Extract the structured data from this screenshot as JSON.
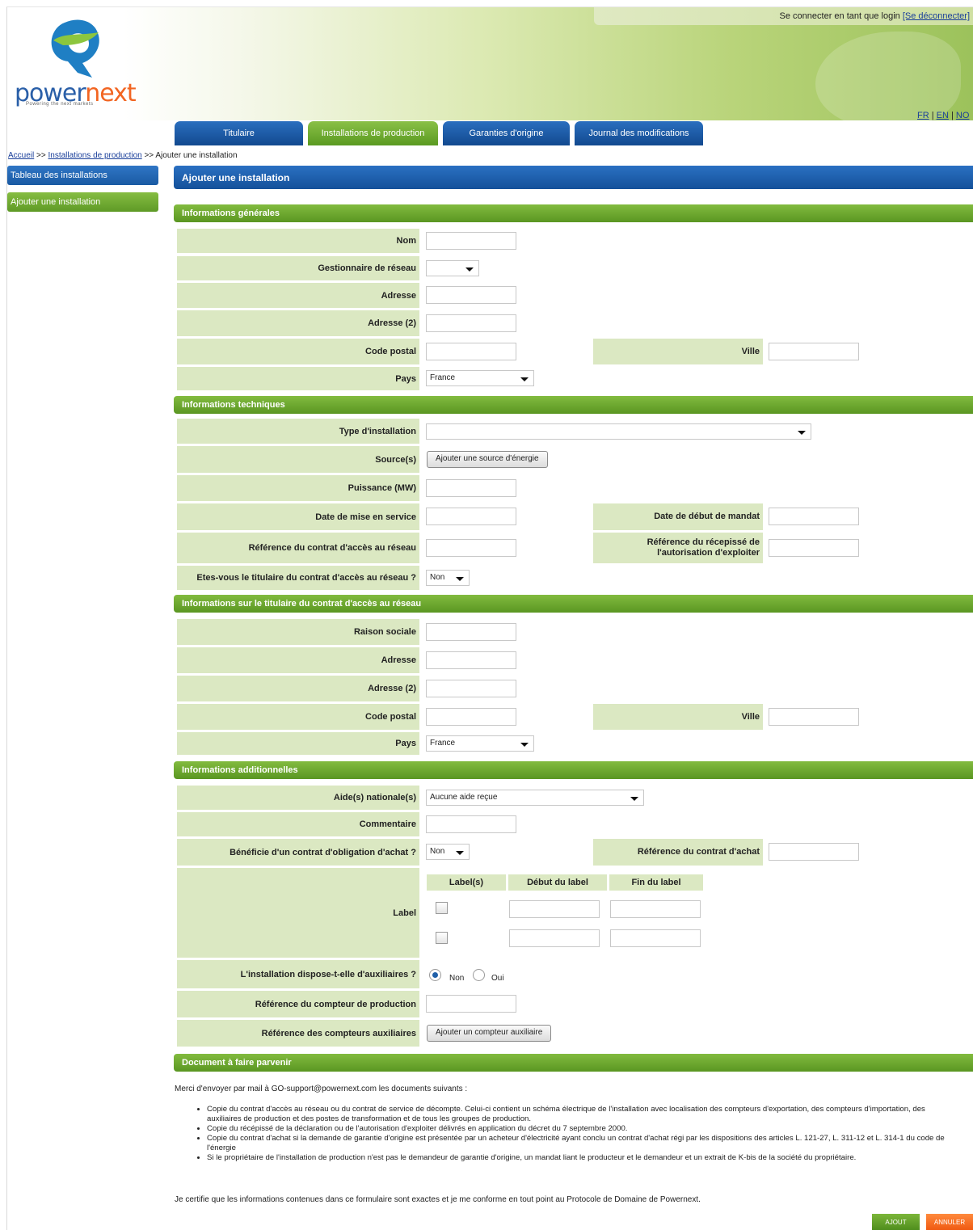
{
  "header": {
    "login_text": "Se connecter en tant que login ",
    "logout_link": "[Se déconnecter]",
    "logo_text_1": "power",
    "logo_text_2": "next",
    "logo_tagline": "Powering the next markets",
    "lang_fr": "FR",
    "lang_en": "EN",
    "lang_no": "NO",
    "lang_sep": " | "
  },
  "tabs": [
    {
      "label": "Titulaire",
      "active": false
    },
    {
      "label": "Installations de production",
      "active": true
    },
    {
      "label": "Garanties d'origine",
      "active": false
    },
    {
      "label": "Journal des modifications",
      "active": false
    }
  ],
  "breadcrumb": {
    "home": "Accueil",
    "sep": " >> ",
    "section": "Installations de production",
    "current": "Ajouter une installation"
  },
  "sidebar": {
    "items": [
      {
        "label": "Tableau des installations"
      },
      {
        "label": "Ajouter une installation"
      }
    ]
  },
  "page_title": "Ajouter une installation",
  "sections": {
    "general": "Informations générales",
    "technical": "Informations techniques",
    "holder": "Informations sur le titulaire du contrat d'accès au réseau",
    "additional": "Informations additionnelles",
    "document": "Document à faire parvenir"
  },
  "general": {
    "nom": "Nom",
    "gestionnaire": "Gestionnaire de réseau",
    "adresse": "Adresse",
    "adresse2": "Adresse (2)",
    "code_postal": "Code postal",
    "ville": "Ville",
    "pays": "Pays",
    "pays_value": "France"
  },
  "technical": {
    "type": "Type d'installation",
    "sources": "Source(s)",
    "sources_button": "Ajouter une source d'énergie",
    "puissance": "Puissance (MW)",
    "date_service": "Date de mise en service",
    "date_mandat": "Date de début de mandat",
    "ref_contrat": "Référence du contrat d'accès au réseau",
    "ref_recepisse_1": "Référence du récepissé de",
    "ref_recepisse_2": "l'autorisation d'exploiter",
    "titulaire_q": "Etes-vous le titulaire du contrat d'accès au réseau ?",
    "titulaire_value": "Non"
  },
  "holder": {
    "raison": "Raison sociale",
    "adresse": "Adresse",
    "adresse2": "Adresse (2)",
    "code_postal": "Code postal",
    "ville": "Ville",
    "pays": "Pays",
    "pays_value": "France"
  },
  "additional": {
    "aides": "Aide(s) nationale(s)",
    "aides_value": "Aucune aide reçue",
    "commentaire": "Commentaire",
    "obligation_q": "Bénéficie d'un contrat d'obligation d'achat ?",
    "obligation_value": "Non",
    "ref_achat": "Référence du contrat d'achat",
    "label": "Label",
    "col_labels": "Label(s)",
    "col_debut": "Début du label",
    "col_fin": "Fin du label",
    "aux_q": "L'installation dispose-t-elle d'auxiliaires ?",
    "aux_non": "Non",
    "aux_oui": "Oui",
    "aux_selected": "Non",
    "ref_compteur": "Référence du compteur de production",
    "ref_aux": "Référence des compteurs auxiliaires",
    "aux_button": "Ajouter un compteur auxiliaire"
  },
  "document": {
    "intro": "Merci d'envoyer par mail à GO-support@powernext.com les documents suivants :",
    "items": [
      "Copie du contrat d'accès au réseau ou du contrat de service de décompte. Celui-ci contient un schéma électrique de l'installation avec localisation des compteurs d'exportation, des compteurs d'importation, des auxiliaires de production et des postes de transformation et de tous les groupes de production.",
      "Copie du récépissé de la déclaration ou de l'autorisation d'exploiter délivrés en application du décret du 7 septembre 2000.",
      "Copie du contrat d'achat si la demande de garantie d'origine est présentée par un acheteur d'électricité ayant conclu un contrat d'achat régi par les dispositions des articles L. 121-27, L. 311-12 et L. 314-1 du code de l'énergie",
      "Si le propriétaire de l'installation de production n'est pas le demandeur de garantie d'origine, un mandat liant le producteur et le demandeur et un extrait de K-bis de la société du propriétaire."
    ],
    "certify": "Je certifie que les informations contenues dans ce formulaire sont exactes et je me conforme en tout point au Protocole de Domaine de Powernext."
  },
  "actions": {
    "ajout": "AJOUT",
    "annuler": "ANNULER"
  },
  "colors": {
    "blue": "#1a5aa3",
    "green": "#6aa82e",
    "label_bg": "#dbe8c2",
    "orange": "#f26522"
  }
}
